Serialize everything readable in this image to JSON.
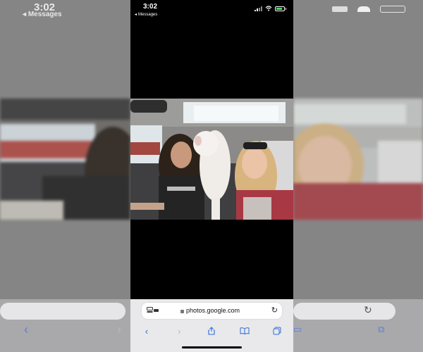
{
  "status": {
    "time": "3:02",
    "back_label": "Messages"
  },
  "photo": {
    "description_icon": "photo-icon"
  },
  "browser": {
    "url": "photos.google.com",
    "reader_icon": "page-settings-icon",
    "reload_icon": "reload-icon"
  },
  "toolbar": {
    "items": [
      "back-icon",
      "forward-icon",
      "share-icon",
      "bookmarks-icon",
      "tabs-icon"
    ]
  },
  "colors": {
    "accent": "#2f6ad9",
    "side_panel": "#858585",
    "toolbar_bg": "#e9e9eb"
  }
}
